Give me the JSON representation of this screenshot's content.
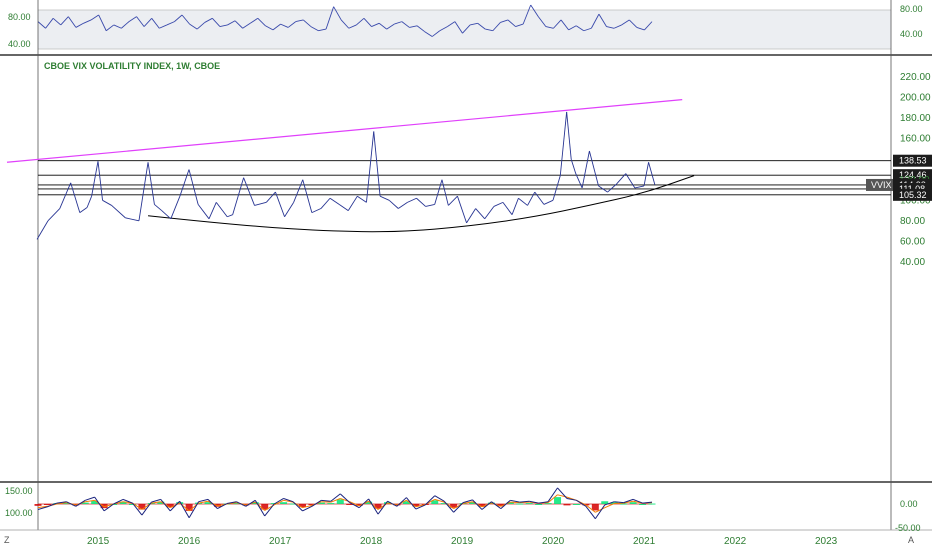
{
  "chart_data": [
    {
      "type": "line",
      "panel": "oscillator-top",
      "ylim": [
        30,
        90
      ],
      "yticks_left": [
        "80.00",
        "40.00"
      ],
      "yticks_right": [
        "80.00",
        "40.00"
      ],
      "band": [
        33,
        80
      ],
      "series": [
        {
          "values": [
            66,
            58,
            70,
            62,
            72,
            59,
            64,
            68,
            74,
            55,
            62,
            58,
            66,
            72,
            60,
            70,
            58,
            62,
            66,
            74,
            63,
            57,
            65,
            70,
            60,
            62,
            67,
            58,
            64,
            70,
            61,
            56,
            63,
            59,
            66,
            68,
            60,
            55,
            57,
            84,
            68,
            58,
            62,
            70,
            60,
            64,
            57,
            63,
            66,
            59,
            61,
            54,
            48,
            55,
            60,
            66,
            52,
            62,
            64,
            57,
            55,
            65,
            68,
            60,
            63,
            86,
            72,
            60,
            58,
            68,
            56,
            61,
            55,
            58,
            75,
            60,
            58,
            62,
            68,
            59,
            56,
            66
          ]
        }
      ]
    },
    {
      "type": "line",
      "panel": "main",
      "title": "CBOE VIX VOLATILITY INDEX, 1W, CBOE",
      "ylim": [
        20,
        230
      ],
      "yticks": [
        "220.00",
        "200.00",
        "180.00",
        "160.00",
        "140.00",
        "120.00",
        "100.00",
        "80.00",
        "60.00",
        "40.00"
      ],
      "xticks": [
        "2015",
        "2016",
        "2017",
        "2018",
        "2019",
        "2020",
        "2021",
        "2022",
        "2023"
      ],
      "x": [
        2014.33,
        2014.45,
        2014.58,
        2014.7,
        2014.8,
        2014.88,
        2014.93,
        2015.0,
        2015.05,
        2015.15,
        2015.3,
        2015.45,
        2015.55,
        2015.62,
        2015.7,
        2015.8,
        2015.9,
        2016.0,
        2016.1,
        2016.22,
        2016.3,
        2016.42,
        2016.48,
        2016.6,
        2016.72,
        2016.85,
        2016.95,
        2017.05,
        2017.15,
        2017.25,
        2017.35,
        2017.45,
        2017.55,
        2017.65,
        2017.75,
        2017.85,
        2017.95,
        2018.03,
        2018.1,
        2018.2,
        2018.3,
        2018.4,
        2018.5,
        2018.6,
        2018.7,
        2018.78,
        2018.85,
        2018.95,
        2019.05,
        2019.15,
        2019.25,
        2019.35,
        2019.45,
        2019.55,
        2019.62,
        2019.72,
        2019.8,
        2019.9,
        2020.0,
        2020.08,
        2020.15,
        2020.2,
        2020.25,
        2020.32,
        2020.4,
        2020.5,
        2020.6,
        2020.7,
        2020.8,
        2020.9,
        2021.0,
        2021.05,
        2021.12
      ],
      "values": [
        62,
        80,
        92,
        117,
        88,
        93,
        104,
        138,
        100,
        95,
        83,
        80,
        137,
        96,
        90,
        82,
        104,
        130,
        96,
        82,
        98,
        84,
        86,
        122,
        95,
        98,
        108,
        84,
        98,
        120,
        88,
        92,
        102,
        96,
        90,
        104,
        98,
        167,
        104,
        100,
        92,
        98,
        102,
        94,
        96,
        120,
        95,
        104,
        78,
        92,
        82,
        94,
        98,
        86,
        102,
        95,
        108,
        96,
        100,
        124,
        186,
        140,
        126,
        112,
        148,
        114,
        108,
        116,
        126,
        112,
        114,
        137,
        115
      ],
      "horizontal_levels": [
        138.53,
        124.46,
        114.93,
        111.08,
        105.32
      ],
      "right_labels": [
        "138.53",
        "124.46",
        "120.00",
        "114.93",
        "1d 14h",
        "111.08",
        "105.32"
      ],
      "symbol_badge": "VVIX",
      "upper_trendline": {
        "from": [
          2014.0,
          137
        ],
        "to": [
          2021.42,
          198
        ]
      },
      "lower_curve_points": [
        [
          2015.55,
          85
        ],
        [
          2016.5,
          76
        ],
        [
          2017.5,
          70
        ],
        [
          2018.3,
          69
        ],
        [
          2019.1,
          75
        ],
        [
          2019.8,
          84
        ],
        [
          2020.4,
          95
        ],
        [
          2021.0,
          107
        ],
        [
          2021.55,
          124
        ]
      ],
      "colors": {
        "series": "#283593",
        "upper_trendline": "#e040fb",
        "levels": "#000000",
        "lower_curve": "#000000",
        "badge": "#555555"
      }
    },
    {
      "type": "area",
      "panel": "oscillator-bottom",
      "ylim": [
        -60,
        25
      ],
      "yticks_left": [
        "150.00",
        "100.00"
      ],
      "yticks_right": [
        "0.00",
        "-50.00"
      ],
      "signal_level": 0,
      "series": [
        {
          "name": "macd",
          "values": [
            -12,
            -6,
            2,
            5,
            -5,
            8,
            15,
            -15,
            0,
            10,
            2,
            -24,
            4,
            10,
            -15,
            6,
            -30,
            5,
            10,
            -10,
            1,
            5,
            -5,
            8,
            -26,
            0,
            12,
            5,
            -15,
            -5,
            8,
            6,
            22,
            3,
            -8,
            11,
            -22,
            6,
            -5,
            14,
            -11,
            -2,
            18,
            6,
            -18,
            3,
            9,
            -12,
            5,
            -10,
            8,
            4,
            6,
            2,
            5,
            35,
            12,
            8,
            -5,
            -32,
            -2,
            5,
            3,
            10,
            2,
            4
          ]
        },
        {
          "name": "signal",
          "values": [
            -8,
            -5,
            0,
            3,
            -2,
            5,
            8,
            -6,
            0,
            5,
            2,
            -12,
            2,
            5,
            -8,
            2,
            -15,
            2,
            6,
            -4,
            0,
            3,
            -2,
            4,
            -14,
            -2,
            8,
            4,
            -8,
            -3,
            5,
            4,
            12,
            5,
            -4,
            6,
            -12,
            2,
            -2,
            8,
            -6,
            -1,
            10,
            4,
            -10,
            1,
            5,
            -6,
            2,
            -5,
            4,
            3,
            4,
            2,
            3,
            20,
            15,
            8,
            -2,
            -18,
            -8,
            1,
            2,
            6,
            2,
            3
          ]
        }
      ],
      "colors": {
        "macd": "#1a237e",
        "signal": "#f57c00",
        "hist_pos": "#00e676",
        "hist_neg": "#d50000",
        "level": "#c62828"
      }
    }
  ],
  "corner_labels": {
    "left": "Z",
    "right": "A"
  }
}
